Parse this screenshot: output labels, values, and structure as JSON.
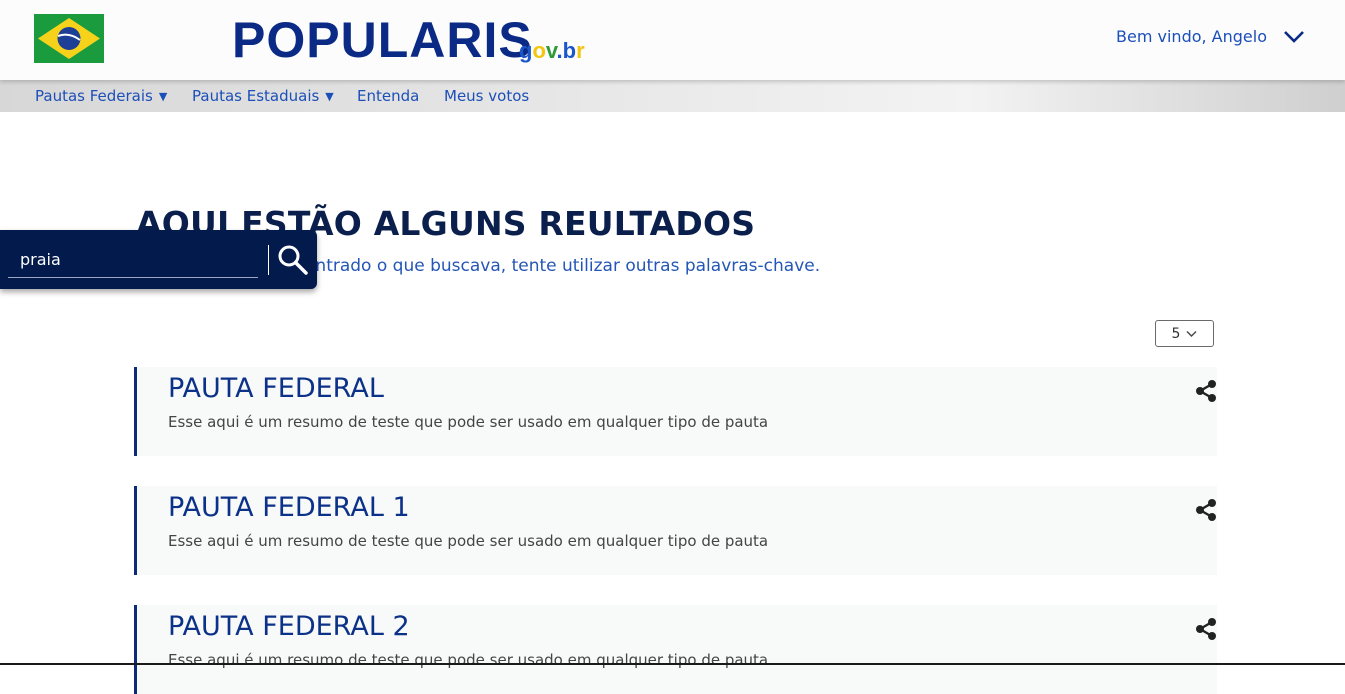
{
  "header": {
    "brand": "POPULARIS",
    "gov_parts": [
      "g",
      "o",
      "v",
      ".b",
      "r"
    ],
    "user_greeting": "Bem vindo, Angelo"
  },
  "nav": {
    "items": [
      {
        "label": "Pautas Federais",
        "has_caret": true
      },
      {
        "label": "Pautas Estaduais",
        "has_caret": true
      },
      {
        "label": "Entenda",
        "has_caret": false
      },
      {
        "label": "Meus votos",
        "has_caret": false
      }
    ],
    "caret": "▼"
  },
  "main": {
    "title": "AQUI ESTÃO ALGUNS REULTADOS",
    "subtitle": "Caso não tenha encontrado o que buscava, tente utilizar outras palavras-chave.",
    "page_size": "5"
  },
  "search": {
    "value": "praia"
  },
  "results": [
    {
      "title": "PAUTA FEDERAL",
      "summary": "Esse aqui é um resumo de teste que pode ser usado em qualquer tipo de pauta"
    },
    {
      "title": "PAUTA FEDERAL 1",
      "summary": "Esse aqui é um resumo de teste que pode ser usado em qualquer tipo de pauta"
    },
    {
      "title": "PAUTA FEDERAL 2",
      "summary": "Esse aqui é um resumo de teste que pode ser usado em qualquer tipo de pauta"
    }
  ],
  "icons": {
    "flag": "brazil-flag-icon",
    "user_menu": "chevron-down-icon",
    "search": "search-icon",
    "share": "share-icon",
    "select": "chevron-down-icon"
  },
  "colors": {
    "brand_blue": "#0a2a86",
    "link_blue": "#1c4fb8",
    "search_bg": "#031a4d",
    "card_border": "#0b2a7a"
  }
}
